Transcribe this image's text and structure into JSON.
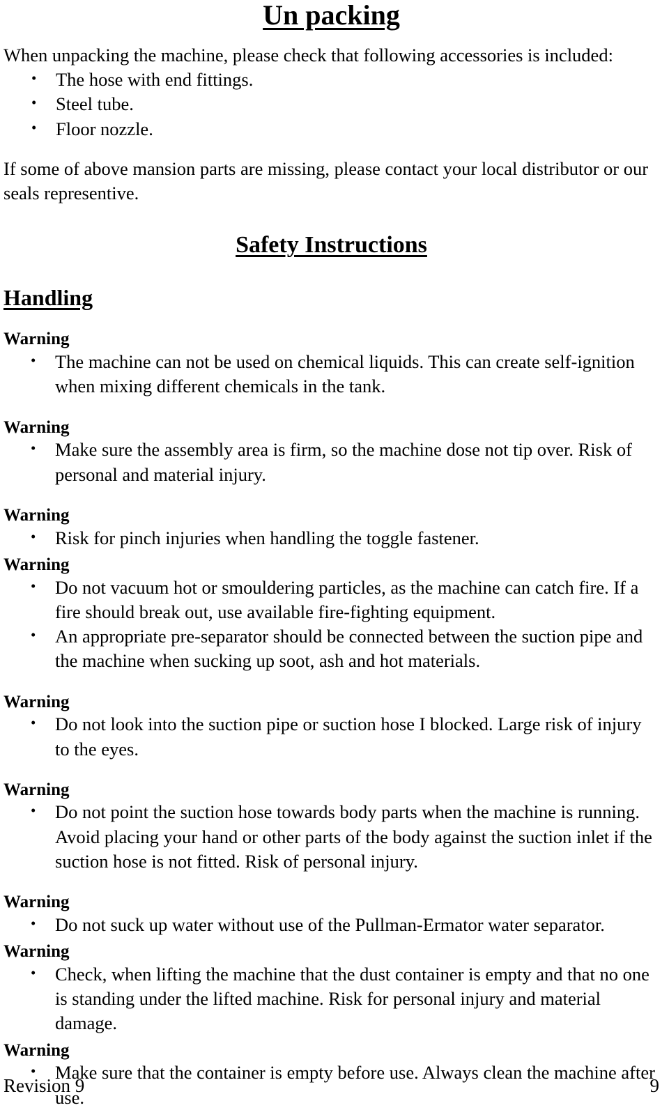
{
  "document": {
    "title": "Un packing",
    "intro_paragraph": "When unpacking the machine, please check that following accessories is included:",
    "accessories": [
      "The hose with end fittings.",
      "Steel tube.",
      "Floor nozzle."
    ],
    "missing_parts_paragraph": "If some of above mansion parts are missing, please contact your local distributor or our seals representive.",
    "safety_heading": "Safety Instructions",
    "handling_heading": "Handling",
    "warning_label": "Warning",
    "warnings": [
      {
        "label": "Warning",
        "items": [
          "The machine can not be used on chemical liquids. This can create self-ignition when mixing different chemicals in the tank."
        ]
      },
      {
        "label": "Warning",
        "items": [
          "Make sure the assembly area is firm, so the machine dose not tip over. Risk of personal and material injury."
        ]
      },
      {
        "label": "Warning",
        "items": [
          "Risk for pinch injuries when handling the toggle fastener."
        ]
      },
      {
        "label": "Warning",
        "items": [
          "Do not vacuum hot or smouldering particles, as the machine can catch fire. If a fire should break out, use available fire-fighting equipment.",
          "An appropriate pre-separator should be connected between the suction pipe and the machine when sucking up soot, ash and hot materials."
        ]
      },
      {
        "label": "Warning",
        "items": [
          "Do not look into the suction pipe or suction hose I blocked. Large risk of injury to the eyes."
        ]
      },
      {
        "label": "Warning",
        "items": [
          "Do not point the suction hose towards body parts when the machine is running. Avoid placing your hand or other parts of the body against the suction inlet if the suction hose is not fitted. Risk of personal injury."
        ]
      },
      {
        "label": "Warning",
        "items": [
          "Do not suck up water without use of the Pullman-Ermator water separator."
        ]
      },
      {
        "label": "Warning",
        "items": [
          "Check, when lifting the machine that the dust container is empty and that no one is standing under the lifted machine. Risk for personal injury and material damage."
        ]
      },
      {
        "label": "Warning",
        "items": [
          "Make sure that the container is empty before use. Always clean the machine after use."
        ]
      }
    ],
    "footer": {
      "revision": "Revision 9",
      "page_number": "9"
    }
  }
}
